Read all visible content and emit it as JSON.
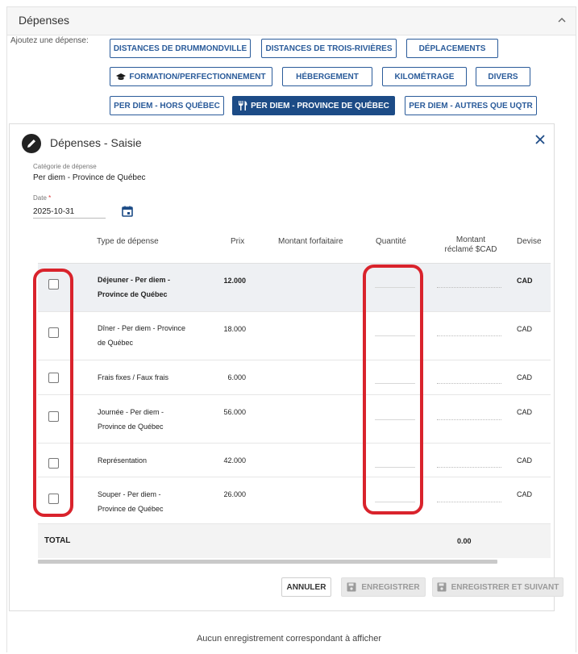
{
  "section": {
    "title": "Dépenses"
  },
  "add_expense": {
    "label": "Ajoutez une dépense:",
    "categories": [
      {
        "label": "DISTANCES DE DRUMMONDVILLE",
        "icon": ""
      },
      {
        "label": "DISTANCES DE TROIS-RIVIÈRES",
        "icon": ""
      },
      {
        "label": "DÉPLACEMENTS",
        "icon": ""
      },
      {
        "label": "FORMATION/PERFECTIONNEMENT",
        "icon": "graduation-cap-icon"
      },
      {
        "label": "HÉBERGEMENT",
        "icon": ""
      },
      {
        "label": "KILOMÉTRAGE",
        "icon": ""
      },
      {
        "label": "DIVERS",
        "icon": ""
      },
      {
        "label": "PER DIEM - HORS QUÉBEC",
        "icon": ""
      },
      {
        "label": "PER DIEM - PROVINCE DE QUÉBEC",
        "icon": "utensils-icon",
        "active": true
      },
      {
        "label": "PER DIEM - AUTRES QUE UQTR",
        "icon": ""
      }
    ]
  },
  "form": {
    "title": "Dépenses - Saisie",
    "category_label": "Catégorie de dépense",
    "category_value": "Per diem - Province de Québec",
    "date_label": "Date",
    "date_required_mark": "*",
    "date_value": "2025-10-31"
  },
  "table": {
    "headers": {
      "type": "Type de dépense",
      "prix": "Prix",
      "forfait": "Montant forfaitaire",
      "quantite": "Quantité",
      "montant_line1": "Montant",
      "montant_line2": "réclamé $CAD",
      "devise": "Devise"
    },
    "rows": [
      {
        "type": "Déjeuner - Per diem - Province de Québec",
        "prix": "12.000",
        "devise": "CAD",
        "highlighted": true
      },
      {
        "type": "Dîner - Per diem - Province de Québec",
        "prix": "18.000",
        "devise": "CAD"
      },
      {
        "type": "Frais fixes / Faux frais",
        "prix": "6.000",
        "devise": "CAD"
      },
      {
        "type": "Journée - Per diem - Province de Québec",
        "prix": "56.000",
        "devise": "CAD"
      },
      {
        "type": "Représentation",
        "prix": "42.000",
        "devise": "CAD"
      },
      {
        "type": "Souper - Per diem - Province de Québec",
        "prix": "26.000",
        "devise": "CAD"
      }
    ],
    "total_label": "TOTAL",
    "total_value": "0.00"
  },
  "buttons": {
    "cancel": "ANNULER",
    "save": "ENREGISTRER",
    "save_next": "ENREGISTRER ET SUIVANT"
  },
  "empty_message": "Aucun enregistrement correspondant à afficher",
  "colors": {
    "primary": "#1c4b86",
    "button_border": "#2a5b9a",
    "annotation_red": "#d9232c"
  }
}
